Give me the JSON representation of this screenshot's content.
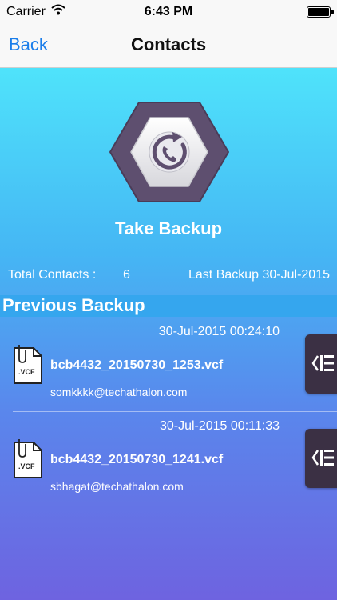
{
  "status_bar": {
    "carrier": "Carrier",
    "time": "6:43 PM"
  },
  "nav": {
    "back_label": "Back",
    "title": "Contacts"
  },
  "backup": {
    "button_label": "Take Backup"
  },
  "stats": {
    "total_label": "Total Contacts :",
    "total_value": "6",
    "last_backup": "Last Backup 30-Jul-2015"
  },
  "section": {
    "title": "Previous Backup"
  },
  "backups": [
    {
      "timestamp": "30-Jul-2015 00:24:10",
      "filename": "bcb4432_20150730_1253.vcf",
      "email": "somkkkk@techathalon.com",
      "icon_text": ".VCF"
    },
    {
      "timestamp": "30-Jul-2015 00:11:33",
      "filename": "bcb4432_20150730_1241.vcf",
      "email": "sbhagat@techathalon.com",
      "icon_text": ".VCF"
    }
  ],
  "colors": {
    "accent": "#1a7dea",
    "hexagon_outer": "#5e4f6f",
    "action_button": "#3b3044",
    "section_bar": "#35a6ee"
  },
  "icons": {
    "wifi": "wifi-icon",
    "battery": "battery-icon",
    "backup": "phone-restore-icon",
    "file": "vcf-file-icon",
    "action": "list-menu-icon"
  }
}
